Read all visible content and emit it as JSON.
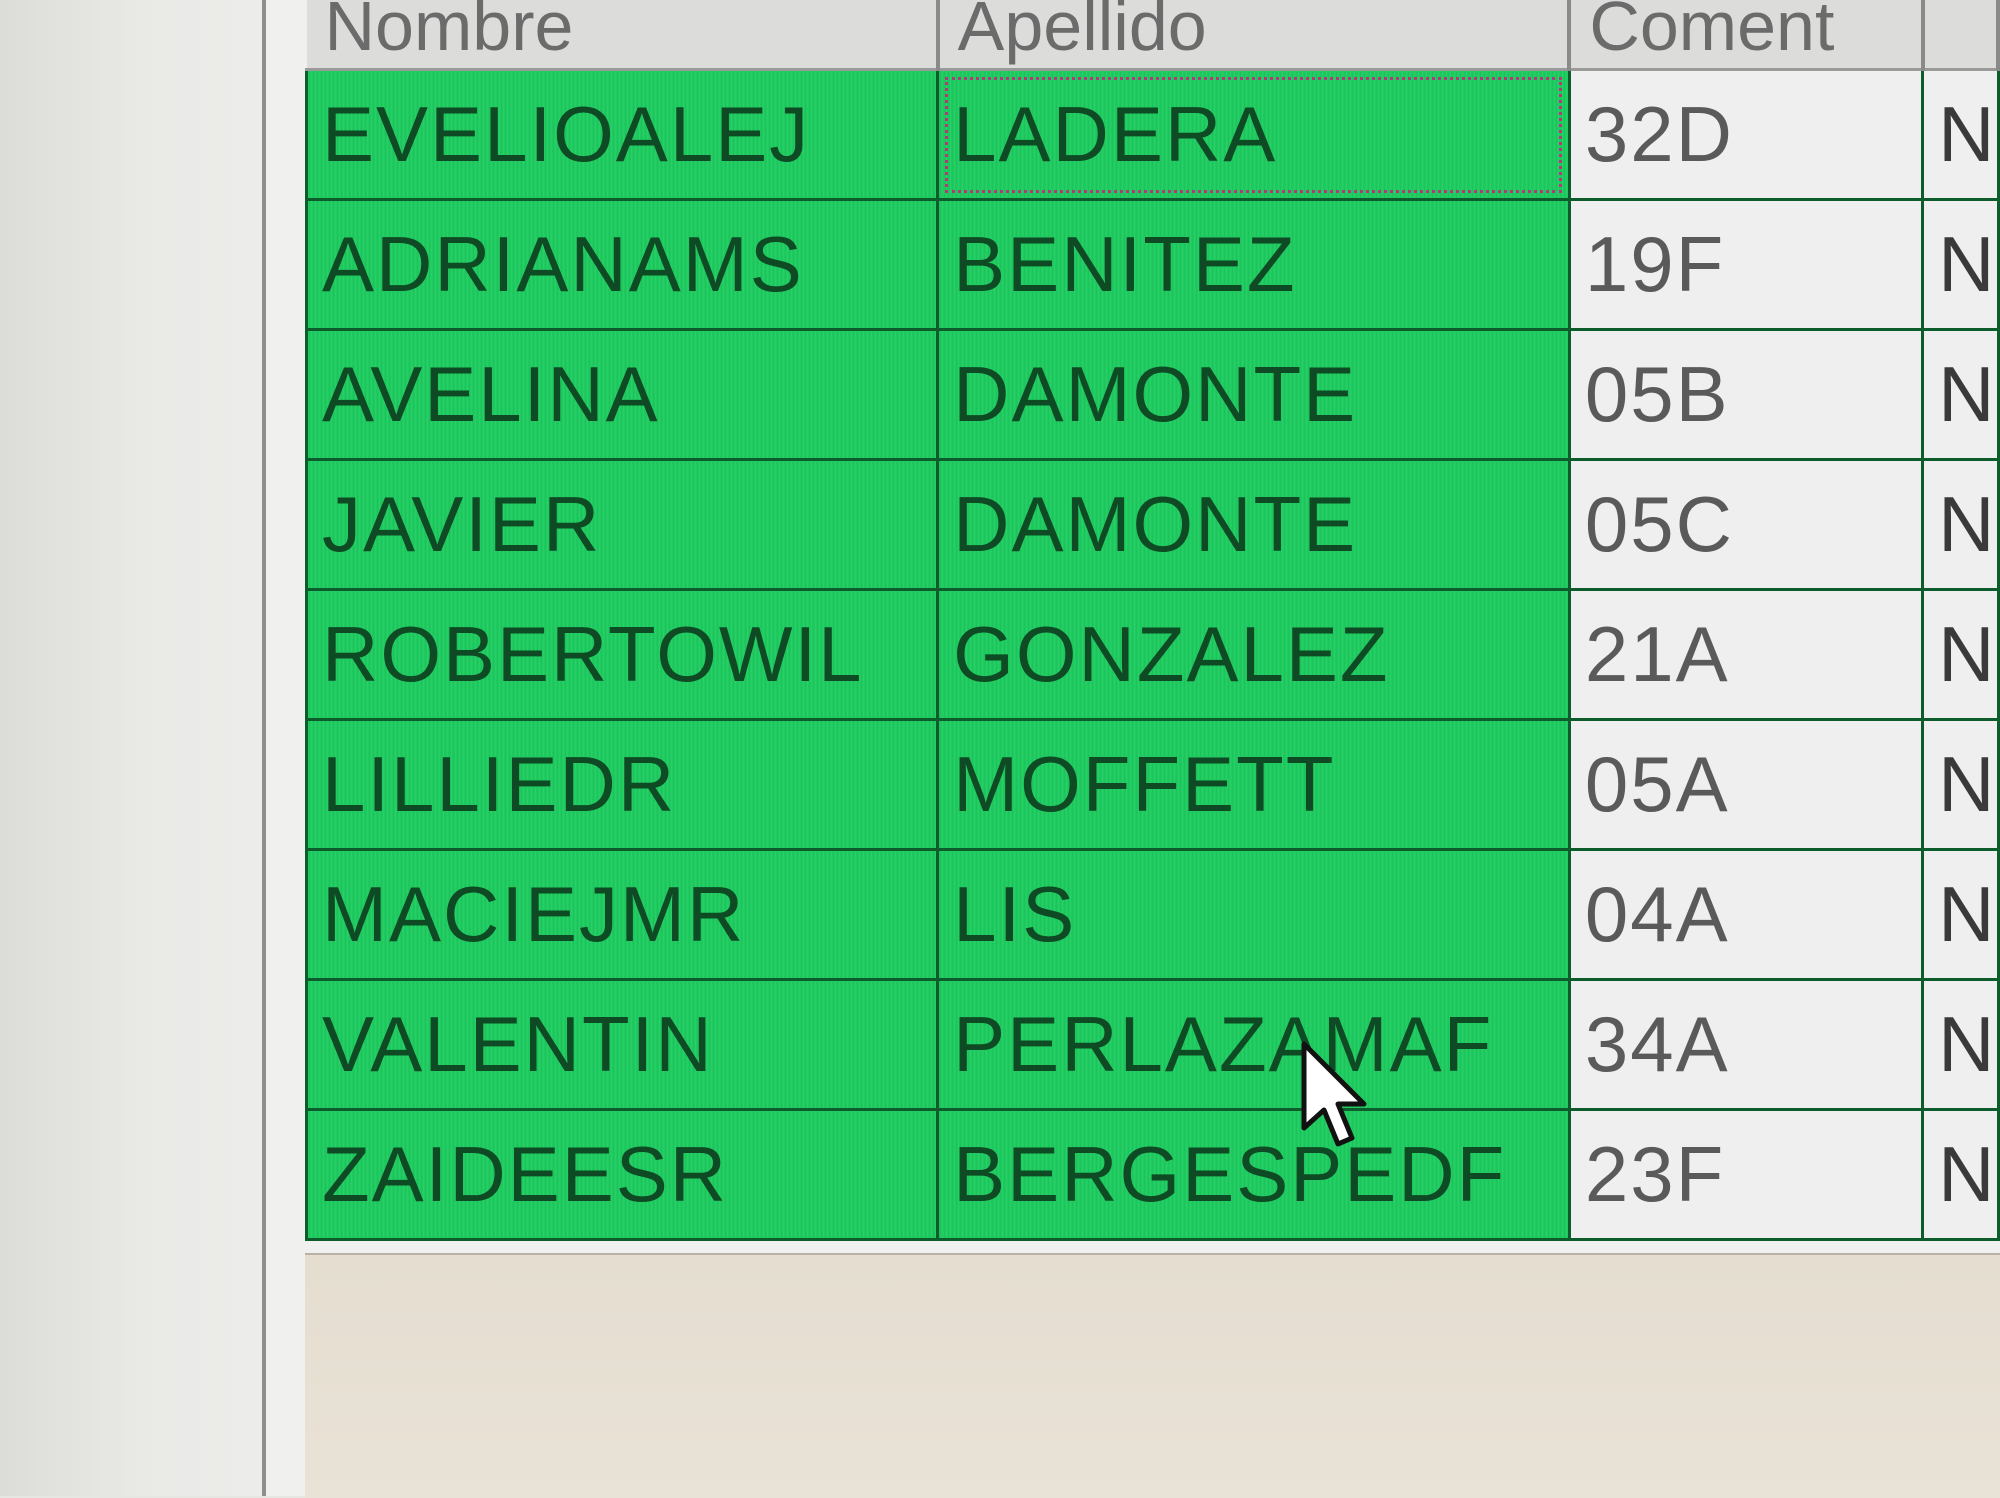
{
  "grid": {
    "columns": [
      "Nombre",
      "Apellido",
      "Coment",
      ""
    ],
    "rows": [
      {
        "nombre": "EVELIOALEJ",
        "apellido": "LADERA",
        "coment": "32D",
        "extra": "N"
      },
      {
        "nombre": "ADRIANAMS",
        "apellido": "BENITEZ",
        "coment": "19F",
        "extra": "N"
      },
      {
        "nombre": "AVELINA",
        "apellido": "DAMONTE",
        "coment": "05B",
        "extra": "N"
      },
      {
        "nombre": "JAVIER",
        "apellido": "DAMONTE",
        "coment": "05C",
        "extra": "N"
      },
      {
        "nombre": "ROBERTOWIL",
        "apellido": "GONZALEZ",
        "coment": "21A",
        "extra": "N"
      },
      {
        "nombre": "LILLIEDR",
        "apellido": "MOFFETT",
        "coment": "05A",
        "extra": "N"
      },
      {
        "nombre": "MACIEJMR",
        "apellido": "LIS",
        "coment": "04A",
        "extra": "N"
      },
      {
        "nombre": "VALENTIN",
        "apellido": "PERLAZAMAF",
        "coment": "34A",
        "extra": "N"
      },
      {
        "nombre": "ZAIDEESR",
        "apellido": "BERGESPEDF",
        "coment": "23F",
        "extra": "N"
      }
    ]
  },
  "colors": {
    "selection": "#1ed061",
    "selection_text": "#0e4a24",
    "grid_line": "#0d5c2c",
    "focus_outline": "#b33a7a"
  },
  "icons": {
    "cursor": "mouse-pointer-icon"
  }
}
